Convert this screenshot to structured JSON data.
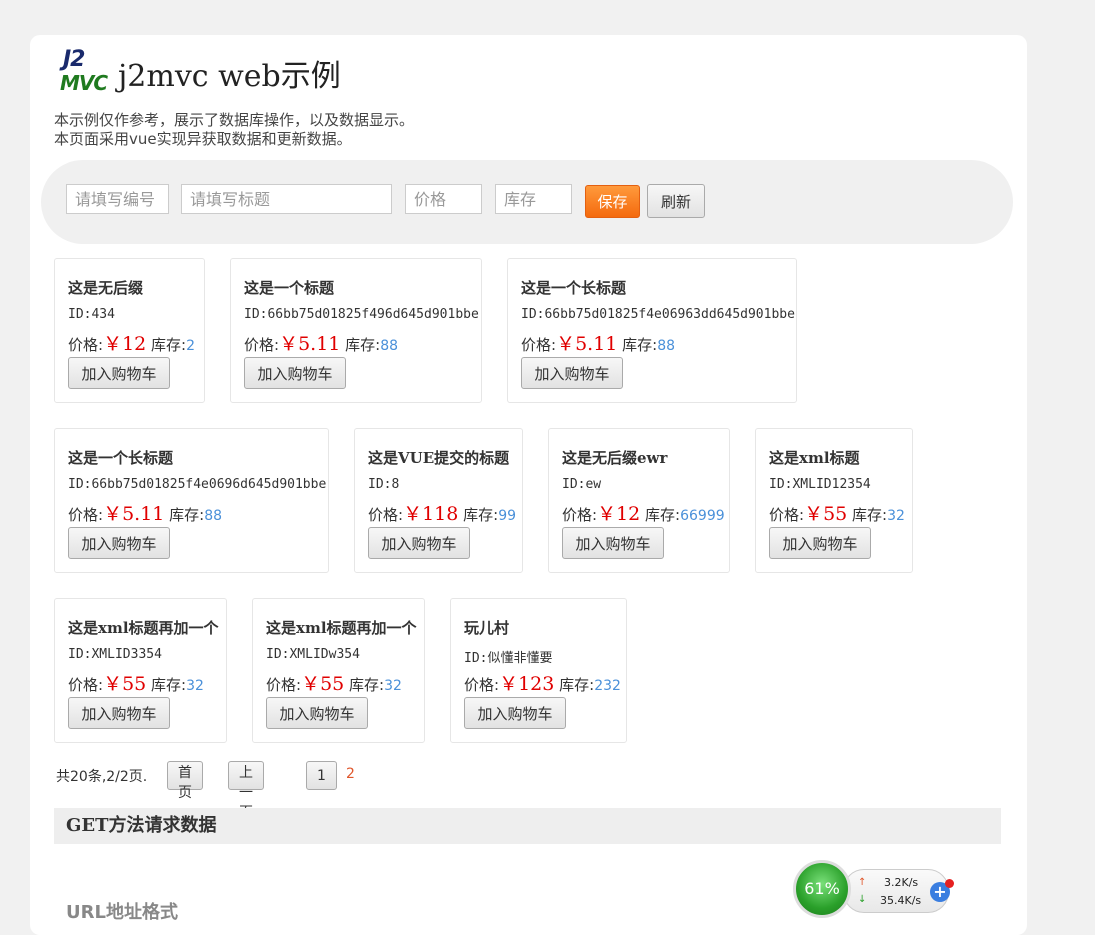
{
  "header": {
    "logo_top": "J2",
    "logo_bottom": "MVC",
    "title": "j2mvc web示例"
  },
  "description": [
    "本示例仅作参考，展示了数据库操作，以及数据显示。",
    "本页面采用vue实现异获取数据和更新数据。"
  ],
  "form": {
    "id_placeholder": "请填写编号",
    "title_placeholder": "请填写标题",
    "price_placeholder": "价格",
    "stock_placeholder": "库存",
    "save_label": "保存",
    "refresh_label": "刷新"
  },
  "card_labels": {
    "price": "价格:",
    "stock": "库存:",
    "currency": "￥",
    "add_to_cart": "加入购物车"
  },
  "products": [
    {
      "title": "这是无后缀",
      "id": "ID:434",
      "price": "12",
      "stock": "2"
    },
    {
      "title": "这是一个标题",
      "id": "ID:66bb75d01825f496d645d901bbe",
      "price": "5.11",
      "stock": "88"
    },
    {
      "title": "这是一个长标题",
      "id": "ID:66bb75d01825f4e06963dd645d901bbe",
      "price": "5.11",
      "stock": "88"
    },
    {
      "title": "这是一个长标题",
      "id": "ID:66bb75d01825f4e0696d645d901bbe",
      "price": "5.11",
      "stock": "88"
    },
    {
      "title": "这是VUE提交的标题",
      "id": "ID:8",
      "price": "118",
      "stock": "99"
    },
    {
      "title": "这是无后缀ewr",
      "id": "ID:ew",
      "price": "12",
      "stock": "66999"
    },
    {
      "title": "这是xml标题",
      "id": "ID:XMLID12354",
      "price": "55",
      "stock": "32"
    },
    {
      "title": "这是xml标题再加一个",
      "id": "ID:XMLID3354",
      "price": "55",
      "stock": "32"
    },
    {
      "title": "这是xml标题再加一个",
      "id": "ID:XMLIDw354",
      "price": "55",
      "stock": "32"
    },
    {
      "title": "玩儿村",
      "id": "ID:似懂非懂要",
      "price": "123",
      "stock": "232"
    }
  ],
  "pager": {
    "info": "共20条,2/2页.",
    "first": "首页",
    "prev": "上一页",
    "page1": "1",
    "current": "2"
  },
  "section": {
    "title": "GET方法请求数据",
    "subtitle": "URL地址格式"
  },
  "net_widget": {
    "percent": "61%",
    "upload": "3.2K/s",
    "download": "35.4K/s"
  }
}
